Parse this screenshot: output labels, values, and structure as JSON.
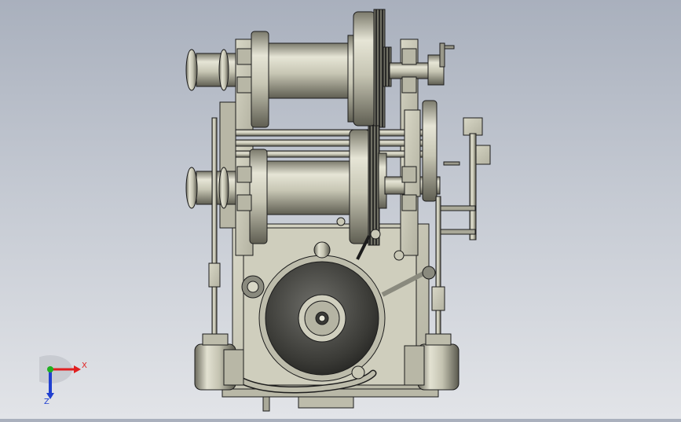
{
  "viewport": {
    "background_top": "#a9b0bd",
    "background_bottom": "#e2e4e8",
    "model_color": "#c9c8b6",
    "model_shadow": "#6e6d60",
    "edge_color": "#1c1c1c"
  },
  "triad": {
    "x_label": "X",
    "z_label": "Z",
    "x_color": "#e02020",
    "y_color": "#20b020",
    "z_color": "#2040d0"
  }
}
